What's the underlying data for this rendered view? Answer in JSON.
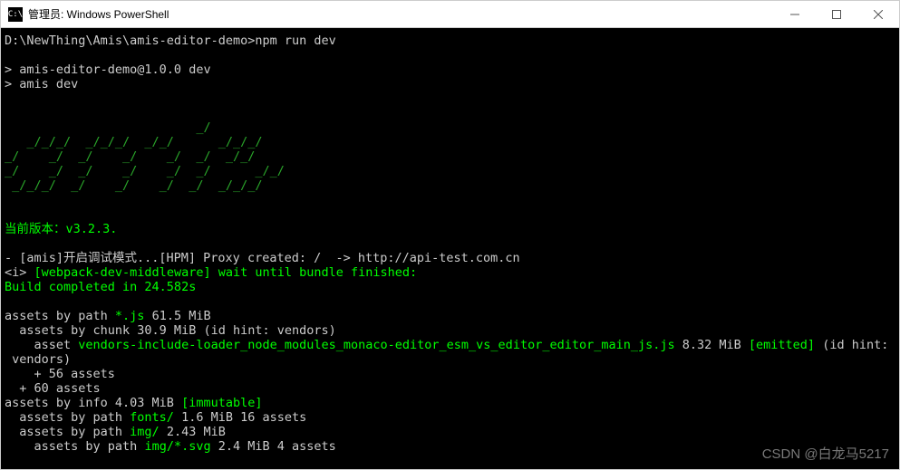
{
  "window": {
    "title": "管理员: Windows PowerShell",
    "icon_label": "C:\\"
  },
  "prompt": {
    "cwd": "D:\\NewThing\\Amis\\amis-editor-demo>",
    "command": "npm run dev"
  },
  "npm_lines": {
    "l1": "> amis-editor-demo@1.0.0 dev",
    "l2": "> amis dev"
  },
  "ascii_art": "                          _/\n   _/_/_/  _/_/_/  _/_/      _/_/_/\n_/    _/  _/    _/    _/  _/  _/_/\n_/    _/  _/    _/    _/  _/      _/_/\n _/_/_/  _/    _/    _/  _/  _/_/_/",
  "version": {
    "label": "当前版本：",
    "value": "v3.2.3."
  },
  "log": {
    "amis_prefix": "- [amis]开启调试模式...",
    "hpm": "[HPM] Proxy created: /  -> http://api-test.com.cn",
    "i_wrap_open": "<i> ",
    "wdm_tag": "[webpack-dev-middleware]",
    "wdm_msg": " wait until bundle finished:",
    "build_done": "Build completed in 24.582s",
    "assets_path_js_1": "assets by path ",
    "assets_path_js_glob": "*.js",
    "assets_path_js_2": " 61.5 MiB",
    "assets_chunk": "  assets by chunk 30.9 MiB (id hint: vendors)",
    "asset_kw": "    asset ",
    "asset_name": "vendors-include-loader_node_modules_monaco-editor_esm_vs_editor_editor_main_js.js",
    "asset_size": " 8.32 MiB ",
    "emitted": "[emitted]",
    "asset_tail": " (id hint:",
    "vendors_line": " vendors)",
    "plus56": "    + 56 assets",
    "plus60": "  + 60 assets",
    "info_1": "assets by info 4.03 MiB ",
    "immutable": "[immutable]",
    "fonts_1": "  assets by path ",
    "fonts_glob": "fonts/",
    "fonts_2": " 1.6 MiB 16 assets",
    "img_1": "  assets by path ",
    "img_glob": "img/",
    "img_2": " 2.43 MiB",
    "svg_1": "    assets by path ",
    "svg_glob": "img/*.svg",
    "svg_2": " 2.4 MiB 4 assets"
  },
  "watermark": "CSDN @白龙马5217"
}
